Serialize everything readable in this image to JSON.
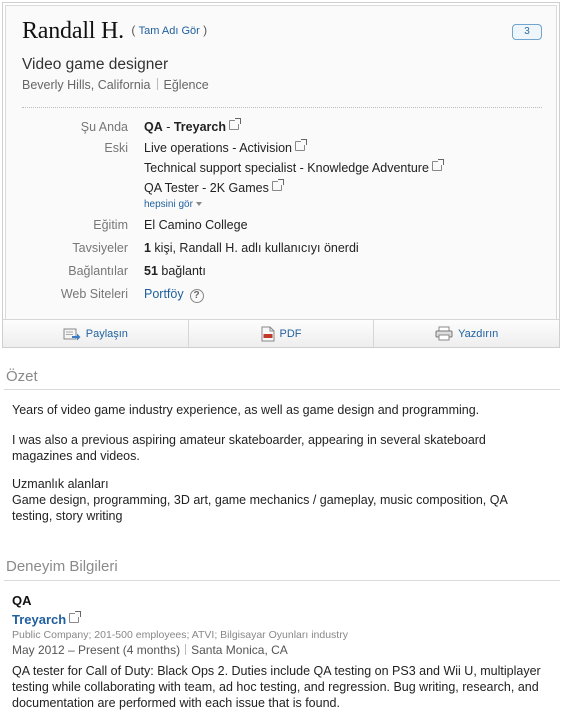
{
  "profile": {
    "name": "Randall H.",
    "fullname_open": "(",
    "fullname_link": "Tam Adı Gör",
    "fullname_close": ")",
    "connection_degree": "3",
    "headline": "Video game designer",
    "location": "Beverly Hills, California",
    "industry": "Eğlence"
  },
  "fields": {
    "current_label": "Şu Anda",
    "current_title": "QA",
    "current_sep": " - ",
    "current_company": "Treyarch",
    "past_label": "Eski",
    "past": [
      {
        "title": "Live operations",
        "sep": " - ",
        "company": "Activision"
      },
      {
        "title": "Technical support specialist",
        "sep": " - ",
        "company": "Knowledge Adventure"
      },
      {
        "title": "QA Tester",
        "sep": " - ",
        "company": "2K Games"
      }
    ],
    "see_all": "hepsini gör",
    "education_label": "Eğitim",
    "education_value": "El Camino College",
    "recommendations_label": "Tavsiyeler",
    "recommendations_count": "1",
    "recommendations_text": " kişi, Randall H. adlı kullanıcıyı önerdi",
    "connections_label": "Bağlantılar",
    "connections_count": "51",
    "connections_text": " bağlantı",
    "websites_label": "Web Siteleri",
    "websites_link": "Portföy",
    "help_glyph": "?"
  },
  "actions": {
    "share": "Paylaşın",
    "pdf": "PDF",
    "print": "Yazdırın",
    "share_icon": "share-icon",
    "pdf_icon": "pdf-icon",
    "print_icon": "printer-icon"
  },
  "summary": {
    "title": "Özet",
    "p1": "Years of video game industry experience, as well as game design and programming.",
    "p2": "I was also a previous aspiring amateur skateboarder, appearing in several skateboard magazines and videos.",
    "specialties_label": "Uzmanlık alanları",
    "specialties": "Game design, programming, 3D art, game mechanics / gameplay, music composition, QA testing, story writing"
  },
  "experience": {
    "title": "Deneyim Bilgileri",
    "job_title": "QA",
    "company": "Treyarch",
    "company_meta": "Public Company; 201-500 employees; ATVI; Bilgisayar Oyunları industry",
    "dates": "May 2012 – Present (4 months)",
    "location": "Santa Monica, CA",
    "description": "QA tester for Call of Duty: Black Ops 2. Duties include QA testing on PS3 and Wii U, multiplayer testing while collaborating with team, ad hoc testing, and regression. Bug writing, research, and documentation are performed with each issue that is found."
  },
  "colors": {
    "link": "#1f5f9e",
    "label": "#777777",
    "section_title": "#8a8a8a"
  }
}
